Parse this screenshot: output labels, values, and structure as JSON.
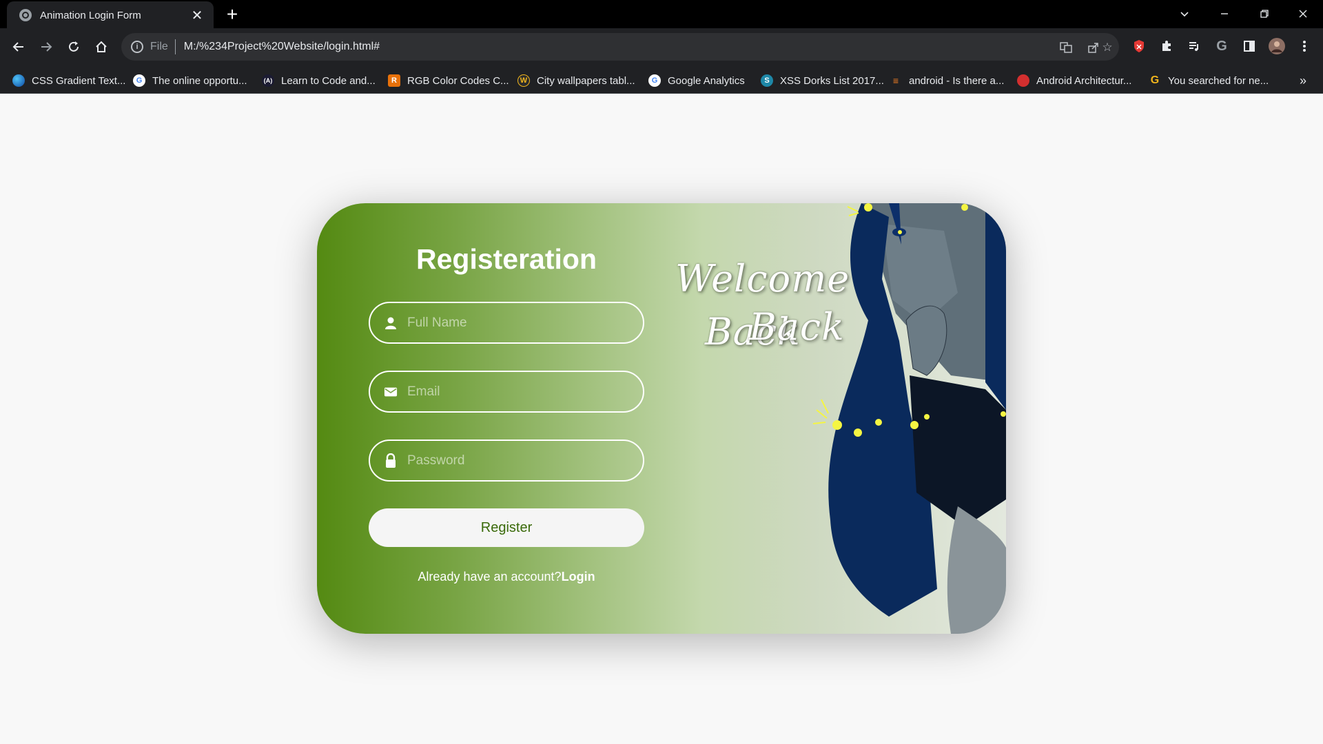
{
  "browser": {
    "tab_title": "Animation Login Form",
    "tab_close": "✕",
    "new_tab": "+",
    "url_scheme": "File",
    "url": "M:/%234Project%20Website/login.html#",
    "bookmarks": [
      {
        "label": "CSS Gradient Text...",
        "color": "#1a73e8",
        "glyph": ""
      },
      {
        "label": "The online opportu...",
        "color": "#ffffff",
        "glyph": "G"
      },
      {
        "label": "Learn to Code and...",
        "color": "#1b1b32",
        "glyph": "(A)"
      },
      {
        "label": "RGB Color Codes C...",
        "color": "#e8710a",
        "glyph": "R"
      },
      {
        "label": "City wallpapers tabl...",
        "color": "#2b2b2b",
        "glyph": "W"
      },
      {
        "label": "Google Analytics",
        "color": "#ffffff",
        "glyph": "G"
      },
      {
        "label": "XSS Dorks List 2017...",
        "color": "#1e88a8",
        "glyph": "S"
      },
      {
        "label": "android - Is there a...",
        "color": "#f48024",
        "glyph": "≡"
      },
      {
        "label": "Android Architectur...",
        "color": "#d32f2f",
        "glyph": "◉"
      },
      {
        "label": "You searched for ne...",
        "color": "#f2b51c",
        "glyph": "G"
      }
    ],
    "more_bookmarks": "»"
  },
  "form": {
    "title": "Registeration",
    "full_name_placeholder": "Full Name",
    "email_placeholder": "Email",
    "password_placeholder": "Password",
    "register_label": "Register",
    "footer_text": "Already have an account?",
    "login_link": "Login"
  },
  "welcome": {
    "line1": "Welcome",
    "line2a": "Back",
    "line2b": "Back"
  },
  "colors": {
    "accent_green": "#548a12",
    "button_text": "#3a6a0a",
    "hair_blue": "#0a2a5c"
  }
}
